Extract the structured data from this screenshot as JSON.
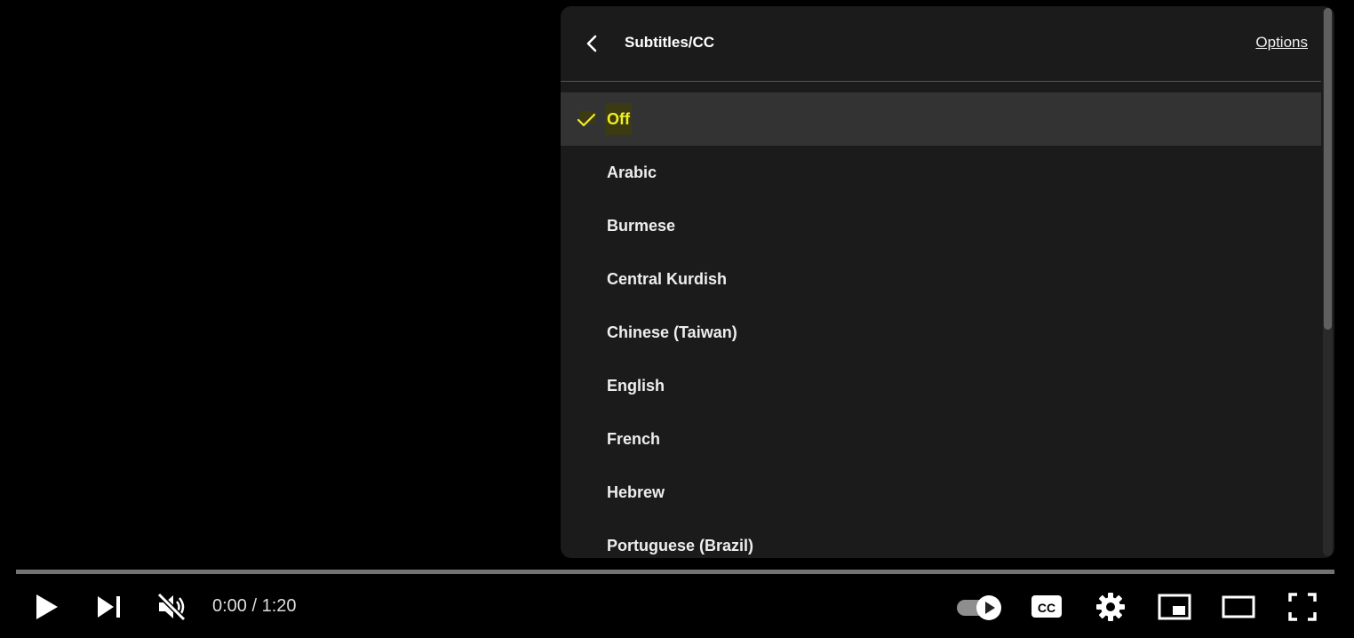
{
  "subtitles_menu": {
    "title": "Subtitles/CC",
    "options_label": "Options",
    "selected": "Off",
    "items": [
      {
        "label": "Off",
        "selected": true
      },
      {
        "label": "Arabic",
        "selected": false
      },
      {
        "label": "Burmese",
        "selected": false
      },
      {
        "label": "Central Kurdish",
        "selected": false
      },
      {
        "label": "Chinese (Taiwan)",
        "selected": false
      },
      {
        "label": "English",
        "selected": false
      },
      {
        "label": "French",
        "selected": false
      },
      {
        "label": "Hebrew",
        "selected": false
      },
      {
        "label": "Portuguese (Brazil)",
        "selected": false
      }
    ]
  },
  "player": {
    "time_display": "0:00 / 1:20",
    "progress": 0,
    "muted": true,
    "autoplay_on": true
  },
  "icons": {
    "back": "chevron-left-icon",
    "check": "check-icon",
    "play": "play-icon",
    "next": "skip-next-icon",
    "mute": "volume-muted-icon",
    "autoplay": "autoplay-toggle-icon",
    "cc": "closed-captions-icon",
    "settings": "gear-icon",
    "miniplayer": "miniplayer-icon",
    "theater": "theater-mode-icon",
    "fullscreen": "fullscreen-icon"
  },
  "colors": {
    "selected_text": "#f0ee2a",
    "panel_bg": "#1c1c1c",
    "selected_row_bg": "#333333"
  }
}
